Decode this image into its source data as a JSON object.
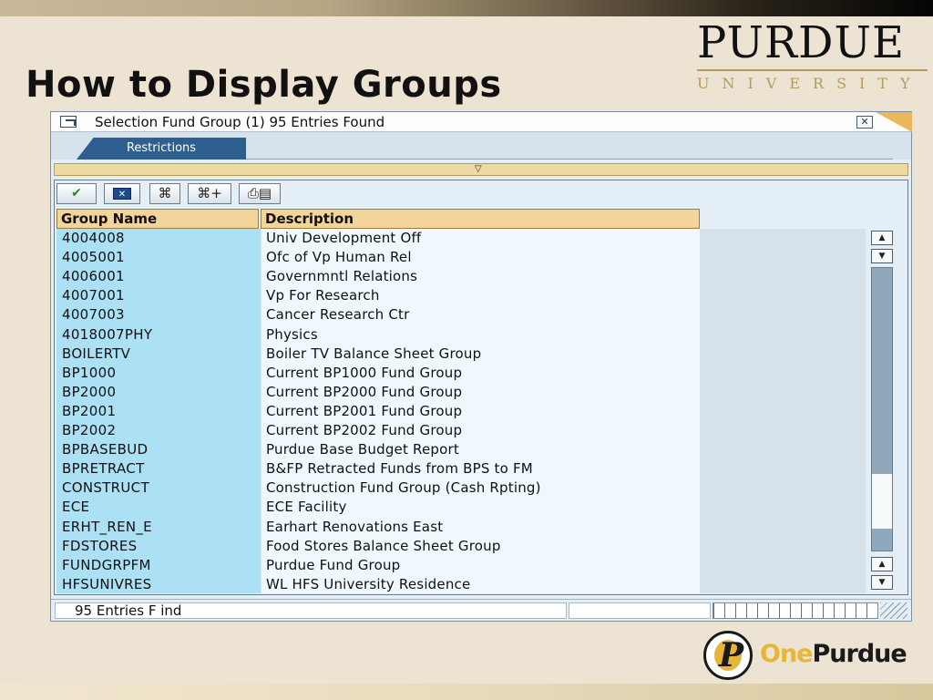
{
  "slide": {
    "title": "How to Display Groups"
  },
  "logo": {
    "wordmark": "PURDUE",
    "sub": "UNIVERSITY",
    "one": "One",
    "purdue": "Purdue",
    "gold": "#b79b54"
  },
  "dialog": {
    "title": "Selection Fund Group (1)  95 Entries Found",
    "close_glyph": "✕",
    "tab_label": "Restrictions",
    "collapse_glyph": "▽",
    "toolbar": {
      "continue_icon": "checkmark-icon",
      "continue_glyph": "✔",
      "cancel_icon": "cancel-icon",
      "cancel_glyph": "✕",
      "find_icon": "binoculars-icon",
      "find_glyph": "⌘",
      "find_next_icon": "binoculars-plus-icon",
      "find_next_glyph": "⌘+",
      "print_icon": "printer-icon",
      "print_glyph": "⎙▤"
    },
    "columns": [
      "Group Name",
      "Description"
    ],
    "rows": [
      {
        "name": "4004008",
        "desc": "Univ Development Off"
      },
      {
        "name": "4005001",
        "desc": "Ofc of Vp Human Rel"
      },
      {
        "name": "4006001",
        "desc": "Governmntl Relations"
      },
      {
        "name": "4007001",
        "desc": "Vp For Research"
      },
      {
        "name": "4007003",
        "desc": "Cancer Research Ctr"
      },
      {
        "name": "4018007PHY",
        "desc": "Physics"
      },
      {
        "name": "BOILERTV",
        "desc": "Boiler TV Balance Sheet Group"
      },
      {
        "name": "BP1000",
        "desc": "Current BP1000 Fund Group"
      },
      {
        "name": "BP2000",
        "desc": "Current BP2000 Fund Group"
      },
      {
        "name": "BP2001",
        "desc": "Current BP2001 Fund Group"
      },
      {
        "name": "BP2002",
        "desc": "Current BP2002 Fund Group"
      },
      {
        "name": "BPBASEBUD",
        "desc": "Purdue Base Budget Report"
      },
      {
        "name": "BPRETRACT",
        "desc": "B&FP Retracted Funds from BPS to FM"
      },
      {
        "name": "CONSTRUCT",
        "desc": "Construction Fund Group (Cash Rpting)"
      },
      {
        "name": "ECE",
        "desc": "ECE Facility"
      },
      {
        "name": "ERHT_REN_E",
        "desc": "Earhart Renovations East"
      },
      {
        "name": "FDSTORES",
        "desc": "Food Stores Balance Sheet Group"
      },
      {
        "name": "FUNDGRPFM",
        "desc": "Purdue Fund Group"
      },
      {
        "name": "HFSUNIVRES",
        "desc": "WL HFS University Residence"
      }
    ],
    "scroll": {
      "up_glyph": "▲",
      "down_glyph": "▼"
    },
    "status": "95 Entries F   ind"
  }
}
